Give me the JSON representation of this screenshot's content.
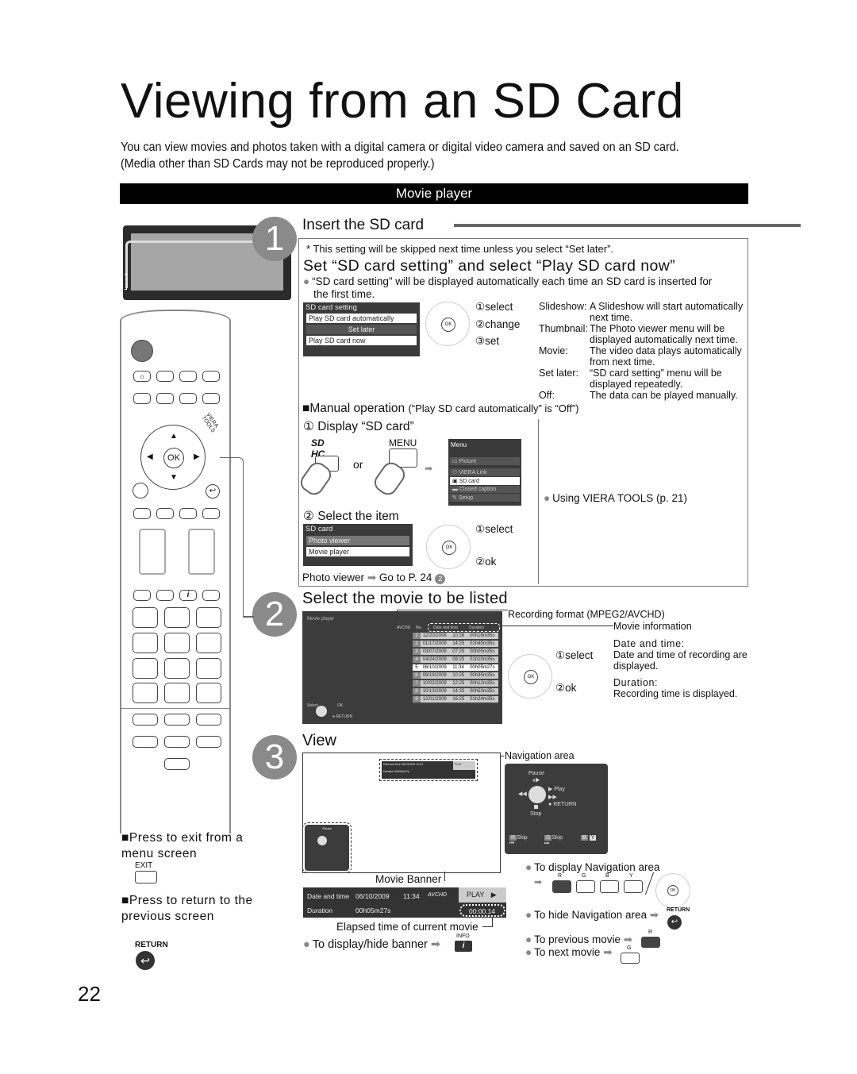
{
  "page": {
    "title": "Viewing from an SD Card",
    "intro": "You can view movies and photos taken with a digital camera or digital video camera and saved on an SD card. (Media other than SD Cards may not be reproduced properly.)",
    "section_bar": "Movie player",
    "page_number": "22"
  },
  "step1": {
    "number": "1",
    "heading": "Insert the SD card",
    "note": "* This setting will be skipped next time unless you select “Set later”.",
    "subheading": "Set “SD card setting” and select “Play SD card now”",
    "bullet": "“SD card setting” will be displayed automatically each time an SD card is inserted for the first time.",
    "osd": {
      "title": "SD card setting",
      "items": [
        "Play SD card automatically",
        "Set later",
        "Play SD card now"
      ]
    },
    "dpad_labels": [
      "①select",
      "②change",
      "③set"
    ],
    "ok_label": "OK",
    "options": [
      {
        "term": "Slideshow:",
        "desc": "A Slideshow will start automatically next time."
      },
      {
        "term": "Thumbnail:",
        "desc": "The Photo viewer menu will be displayed automatically next time."
      },
      {
        "term": "Movie:",
        "desc": "The video data plays automatically from next time."
      },
      {
        "term": "Set later:",
        "desc": "“SD card setting” menu will be displayed repeatedly."
      },
      {
        "term": "Off:",
        "desc": "The data can be played manually."
      }
    ],
    "manual": {
      "heading": "Manual operation",
      "heading_note": "(“Play SD card automatically” is “Off”)",
      "sub1": "① Display “SD card”",
      "menu_key": "MENU",
      "or": "or",
      "menu_osd": {
        "title": "Menu",
        "items": [
          "Picture",
          "VIERA Link",
          "SD card",
          "Closed caption",
          "Setup"
        ]
      },
      "viera_tools": "Using VIERA TOOLS (p. 21)",
      "sub2": "② Select the item",
      "sd_osd": {
        "title": "SD card",
        "items": [
          "Photo viewer",
          "Movie player"
        ]
      },
      "dpad_labels": [
        "①select",
        "②ok"
      ],
      "photo_viewer_note": "Photo viewer",
      "goto": "Go to P. 24",
      "goto_badge": "2"
    }
  },
  "step2": {
    "number": "2",
    "heading": "Select the movie to be listed",
    "screen_title": "Movie player",
    "format_badge": "AVCHD",
    "columns": [
      "No.",
      "Date and time",
      "Duration"
    ],
    "rows": [
      {
        "no": "1",
        "date": "12/20/2008",
        "time": "10:26",
        "dur": "00h16m35s"
      },
      {
        "no": "2",
        "date": "01/17/2009",
        "time": "14:25",
        "dur": "01h45m35s"
      },
      {
        "no": "3",
        "date": "03/07/2009",
        "time": "07:25",
        "dur": "00h05m35s"
      },
      {
        "no": "4",
        "date": "04/24/2009",
        "time": "09:25",
        "dur": "01h10m35s"
      },
      {
        "no": "5",
        "date": "06/10/2009",
        "time": "11:34",
        "dur": "00h05m27s"
      },
      {
        "no": "6",
        "date": "08/19/2009",
        "time": "10:25",
        "dur": "00h35m35s"
      },
      {
        "no": "7",
        "date": "10/02/2009",
        "time": "12:25",
        "dur": "00h12m35s"
      },
      {
        "no": "8",
        "date": "10/13/2009",
        "time": "14:25",
        "dur": "00h53m35s"
      },
      {
        "no": "9",
        "date": "12/01/2009",
        "time": "16:25",
        "dur": "01h24m35s"
      }
    ],
    "selected_row": 5,
    "screen_help": {
      "select": "Select",
      "ok": "OK",
      "return": "RETURN"
    },
    "callouts": {
      "format": "Recording format (MPEG2/AVCHD)",
      "info": "Movie information"
    },
    "dpad_labels": [
      "①select",
      "②ok"
    ],
    "defs": [
      {
        "term": "Date and time:",
        "desc": "Date and time of recording are displayed."
      },
      {
        "term": "Duration:",
        "desc": "Recording time is displayed."
      }
    ]
  },
  "step3": {
    "number": "3",
    "heading": "View",
    "nav_area_label": "Navigation area",
    "nav": {
      "pause": "Pause",
      "play": "Play",
      "return": "RETURN",
      "stop": "Stop",
      "r": "R",
      "g": "G",
      "b": "B",
      "y": "Y",
      "skip": "Skip"
    },
    "banner_label": "Movie Banner",
    "banner": {
      "date_label": "Date and time",
      "date": "06/10/2009",
      "time": "11:34",
      "format": "AVCHD",
      "play": "PLAY",
      "duration_label": "Duration",
      "duration": "00h05m27s",
      "elapsed": "00:00.14"
    },
    "elapsed_label": "Elapsed time of current movie",
    "display_banner": "To display/hide banner",
    "info_key": "INFO",
    "display_nav": "To display Navigation area",
    "hide_nav": "To hide Navigation area",
    "return_key": "RETURN",
    "prev_movie": "To previous movie",
    "next_movie": "To next movie",
    "keys": [
      "R",
      "G",
      "B",
      "Y"
    ]
  },
  "sidebar": {
    "exit_heading": "Press to exit from a menu screen",
    "exit_key": "EXIT",
    "return_heading": "Press to return to the previous screen",
    "return_key": "RETURN",
    "remote_ok": "OK",
    "viera_tools_label": "VIERA TOOLS"
  }
}
